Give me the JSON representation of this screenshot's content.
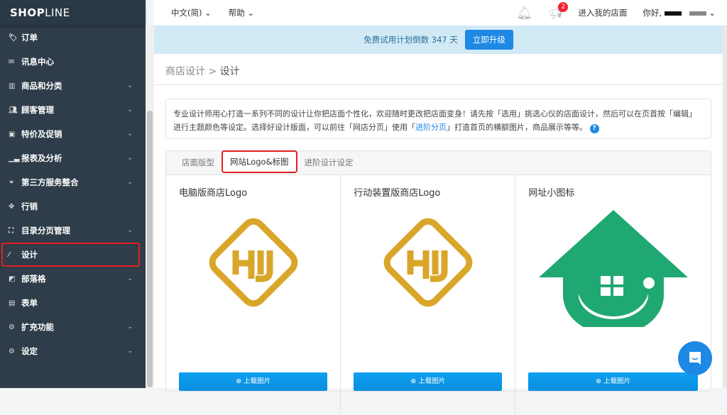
{
  "brand": {
    "name_bold": "SHOP",
    "name_light": "LINE"
  },
  "sidebar": {
    "items": [
      {
        "label": "订单",
        "icon": "tags-icon",
        "chevron": false
      },
      {
        "label": "讯息中心",
        "icon": "envelope-icon",
        "chevron": false
      },
      {
        "label": "商品和分类",
        "icon": "barcode-icon",
        "chevron": true
      },
      {
        "label": "顾客管理",
        "icon": "users-icon",
        "chevron": true
      },
      {
        "label": "特价及促销",
        "icon": "money-icon",
        "chevron": true
      },
      {
        "label": "报表及分析",
        "icon": "bar-chart-icon",
        "chevron": true
      },
      {
        "label": "第三方服务整合",
        "icon": "link-icon",
        "chevron": true
      },
      {
        "label": "行销",
        "icon": "crosshair-icon",
        "chevron": false
      },
      {
        "label": "目录分页管理",
        "icon": "sitemap-icon",
        "chevron": true
      },
      {
        "label": "设计",
        "icon": "magic-wand-icon",
        "chevron": false,
        "highlighted": true
      },
      {
        "label": "部落格",
        "icon": "edit-icon",
        "chevron": true
      },
      {
        "label": "表单",
        "icon": "form-icon",
        "chevron": false
      },
      {
        "label": "扩充功能",
        "icon": "cogs-icon",
        "chevron": true
      },
      {
        "label": "设定",
        "icon": "gear-icon",
        "chevron": true
      }
    ]
  },
  "topbar": {
    "language": "中文(简)",
    "help": "帮助",
    "notifications_badge": "2",
    "store_link": "进入我的店面",
    "greeting": "你好,"
  },
  "banner": {
    "text": "免费试用计划倒数 347 天",
    "button": "立即升级"
  },
  "breadcrumb": {
    "parent": "商店设计",
    "separator": ">",
    "current": "设计"
  },
  "description": {
    "text": "专业设计师用心打造一系列不同的设计让你把店面个性化，欢迎随时更改把店面变身！请先按「选用」挑选心仪的店面设计，然后可以在页首按「编辑」进行主题颜色等设定。选择好设计版面，可以前往「网店分页」使用「",
    "link": "进阶分页",
    "text_after": "」打造首页的横额图片，商品展示等等。"
  },
  "tabs": [
    {
      "label": "店面版型"
    },
    {
      "label": "网站Logo&标图",
      "active": true
    },
    {
      "label": "进阶设计设定"
    }
  ],
  "cards": [
    {
      "title": "电脑版商店Logo",
      "button": "上载图片"
    },
    {
      "title": "行动装置版商店Logo",
      "button": "上载图片"
    },
    {
      "title": "网址小图标",
      "button": "上载图片"
    }
  ],
  "colors": {
    "sidebar": "#2e3d49",
    "accent": "#1e88e5",
    "highlight": "#e02020",
    "gold": "#d9a62a",
    "green": "#20a872"
  }
}
